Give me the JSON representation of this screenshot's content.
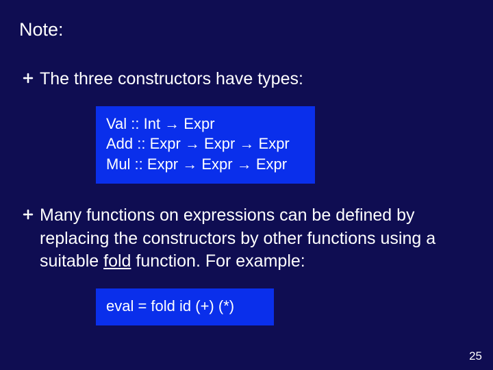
{
  "title": "Note:",
  "bullets": [
    {
      "text": "The three constructors have types:"
    },
    {
      "text_pre": "Many functions on expressions can be defined by replacing the constructors by other functions using a suitable ",
      "text_underline": "fold",
      "text_post": " function.  For example:"
    }
  ],
  "codebox1": {
    "lines": [
      "Val :: Int → Expr",
      "Add :: Expr → Expr → Expr",
      "Mul :: Expr → Expr → Expr"
    ]
  },
  "codebox2": {
    "lines": [
      "eval = fold id (+) (*)"
    ]
  },
  "page_number": "25"
}
